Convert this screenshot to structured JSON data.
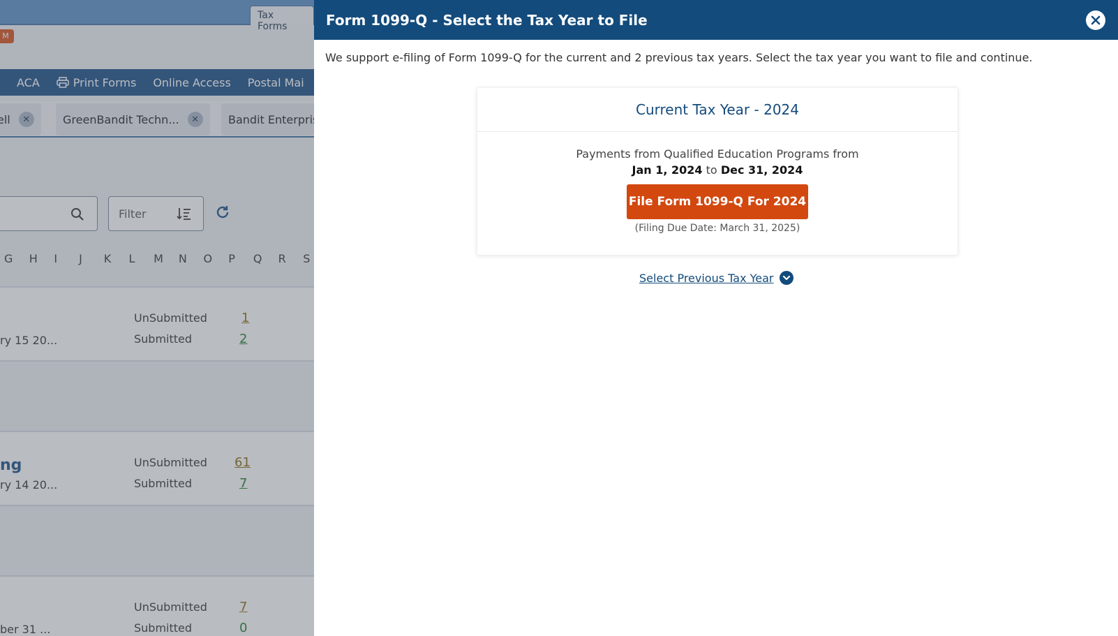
{
  "background": {
    "tab_label": "Tax Forms",
    "badge": "M",
    "nav_items": [
      "ACA",
      "Print Forms",
      "Online Access",
      "Postal Mai"
    ],
    "chips": [
      "ell",
      "GreenBandit Techn...",
      "Bandit Enterpris"
    ],
    "filter_label": "Filter",
    "alphabet": [
      "G",
      "H",
      "I",
      "J",
      "K",
      "L",
      "M",
      "N",
      "O",
      "P",
      "Q",
      "R",
      "S"
    ],
    "rows": [
      {
        "name": "",
        "date": "ry 15 20...",
        "unsubmitted_label": "UnSubmitted",
        "unsubmitted_count": "1",
        "submitted_label": "Submitted",
        "submitted_count": "2"
      },
      {
        "name": "ng",
        "date": "ry 14 20...",
        "unsubmitted_label": "UnSubmitted",
        "unsubmitted_count": "61",
        "submitted_label": "Submitted",
        "submitted_count": "7"
      },
      {
        "name": "",
        "date": "ber 31 ...",
        "unsubmitted_label": "UnSubmitted",
        "unsubmitted_count": "7",
        "submitted_label": "Submitted",
        "submitted_count": "0"
      }
    ]
  },
  "panel": {
    "title": "Form 1099-Q - Select the Tax Year to File",
    "intro": "We support e-filing of Form 1099-Q for the current and 2 previous tax years. Select the tax year you want to file and continue.",
    "card": {
      "title": "Current Tax Year - 2024",
      "period_text": "Payments from Qualified Education Programs from",
      "start_date": "Jan 1, 2024",
      "to_word": "to",
      "end_date": "Dec 31, 2024",
      "button_label": "File Form 1099-Q For 2024",
      "due_date": "(Filing Due Date: March 31, 2025)"
    },
    "previous_link": "Select Previous Tax Year"
  },
  "colors": {
    "header": "#134b7c",
    "button": "#d3480f",
    "nav": "#1a4f86"
  }
}
